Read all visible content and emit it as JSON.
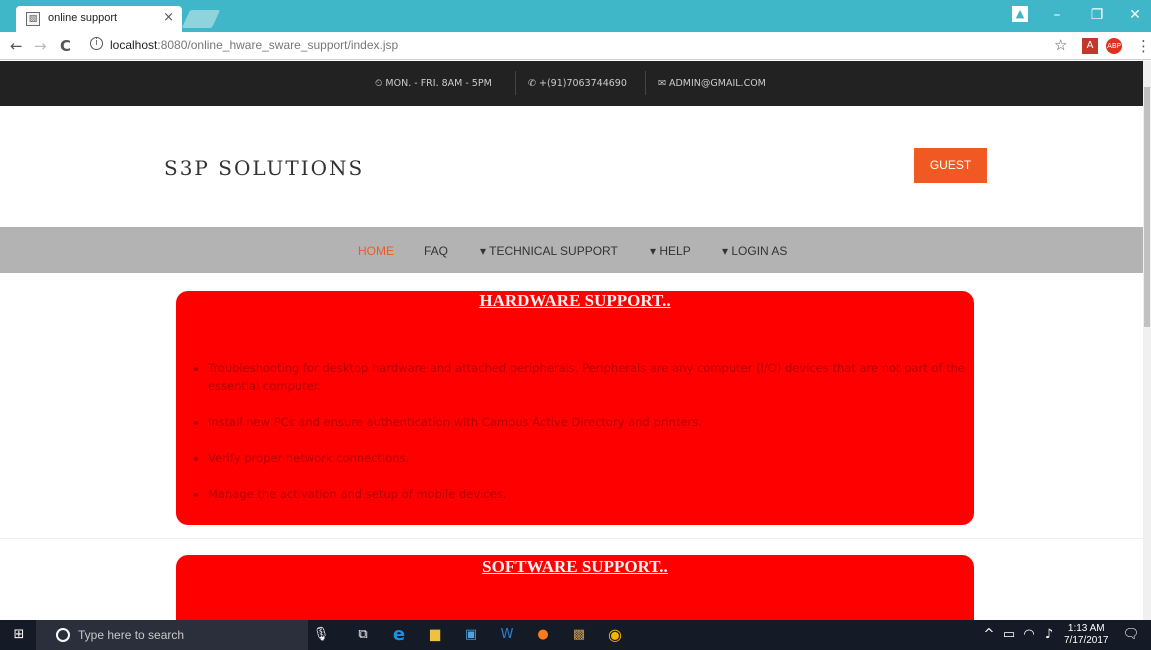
{
  "browser": {
    "tab_title": "online support",
    "tab_close": "×",
    "url_host": "localhost",
    "url_rest": ":8080/online_hware_sware_support/index.jsp",
    "back": "←",
    "forward": "→",
    "reload": "C",
    "star": "☆",
    "window_controls": {
      "minimize": "–",
      "maximize": "❐",
      "close": "✕"
    }
  },
  "topbar": {
    "hours": "⏲ MON. - FRI. 8AM - 5PM",
    "phone": "✆ +(91)7063744690",
    "email": "✉ ADMIN@GMAIL.COM"
  },
  "header": {
    "brand": "S3P SOLUTIONS",
    "guest_button": "GUEST"
  },
  "nav": {
    "items": [
      {
        "label": "HOME",
        "active": true
      },
      {
        "label": "FAQ"
      },
      {
        "label": "▾ TECHNICAL SUPPORT"
      },
      {
        "label": "▾ HELP"
      },
      {
        "label": "▾ LOGIN AS"
      }
    ]
  },
  "hardware": {
    "title": "HARDWARE SUPPORT..",
    "items": [
      "Troubleshooting for desktop hardware and attached peripherals. Peripherals are any computer (I/O) devices that are not part of the essential computer.",
      "Install new PCs and ensure authentication with Campus Active Directory and printers.",
      "Verify proper network connections.",
      "Manage the activation and setup of mobile devices."
    ]
  },
  "software": {
    "title": "SOFTWARE SUPPORT.."
  },
  "taskbar": {
    "search_placeholder": "Type here to search",
    "time": "1:13 AM",
    "date": "7/17/2017"
  },
  "colors": {
    "accent": "#f05a22",
    "card": "#ff0000",
    "chrome": "#3fb7c9"
  }
}
